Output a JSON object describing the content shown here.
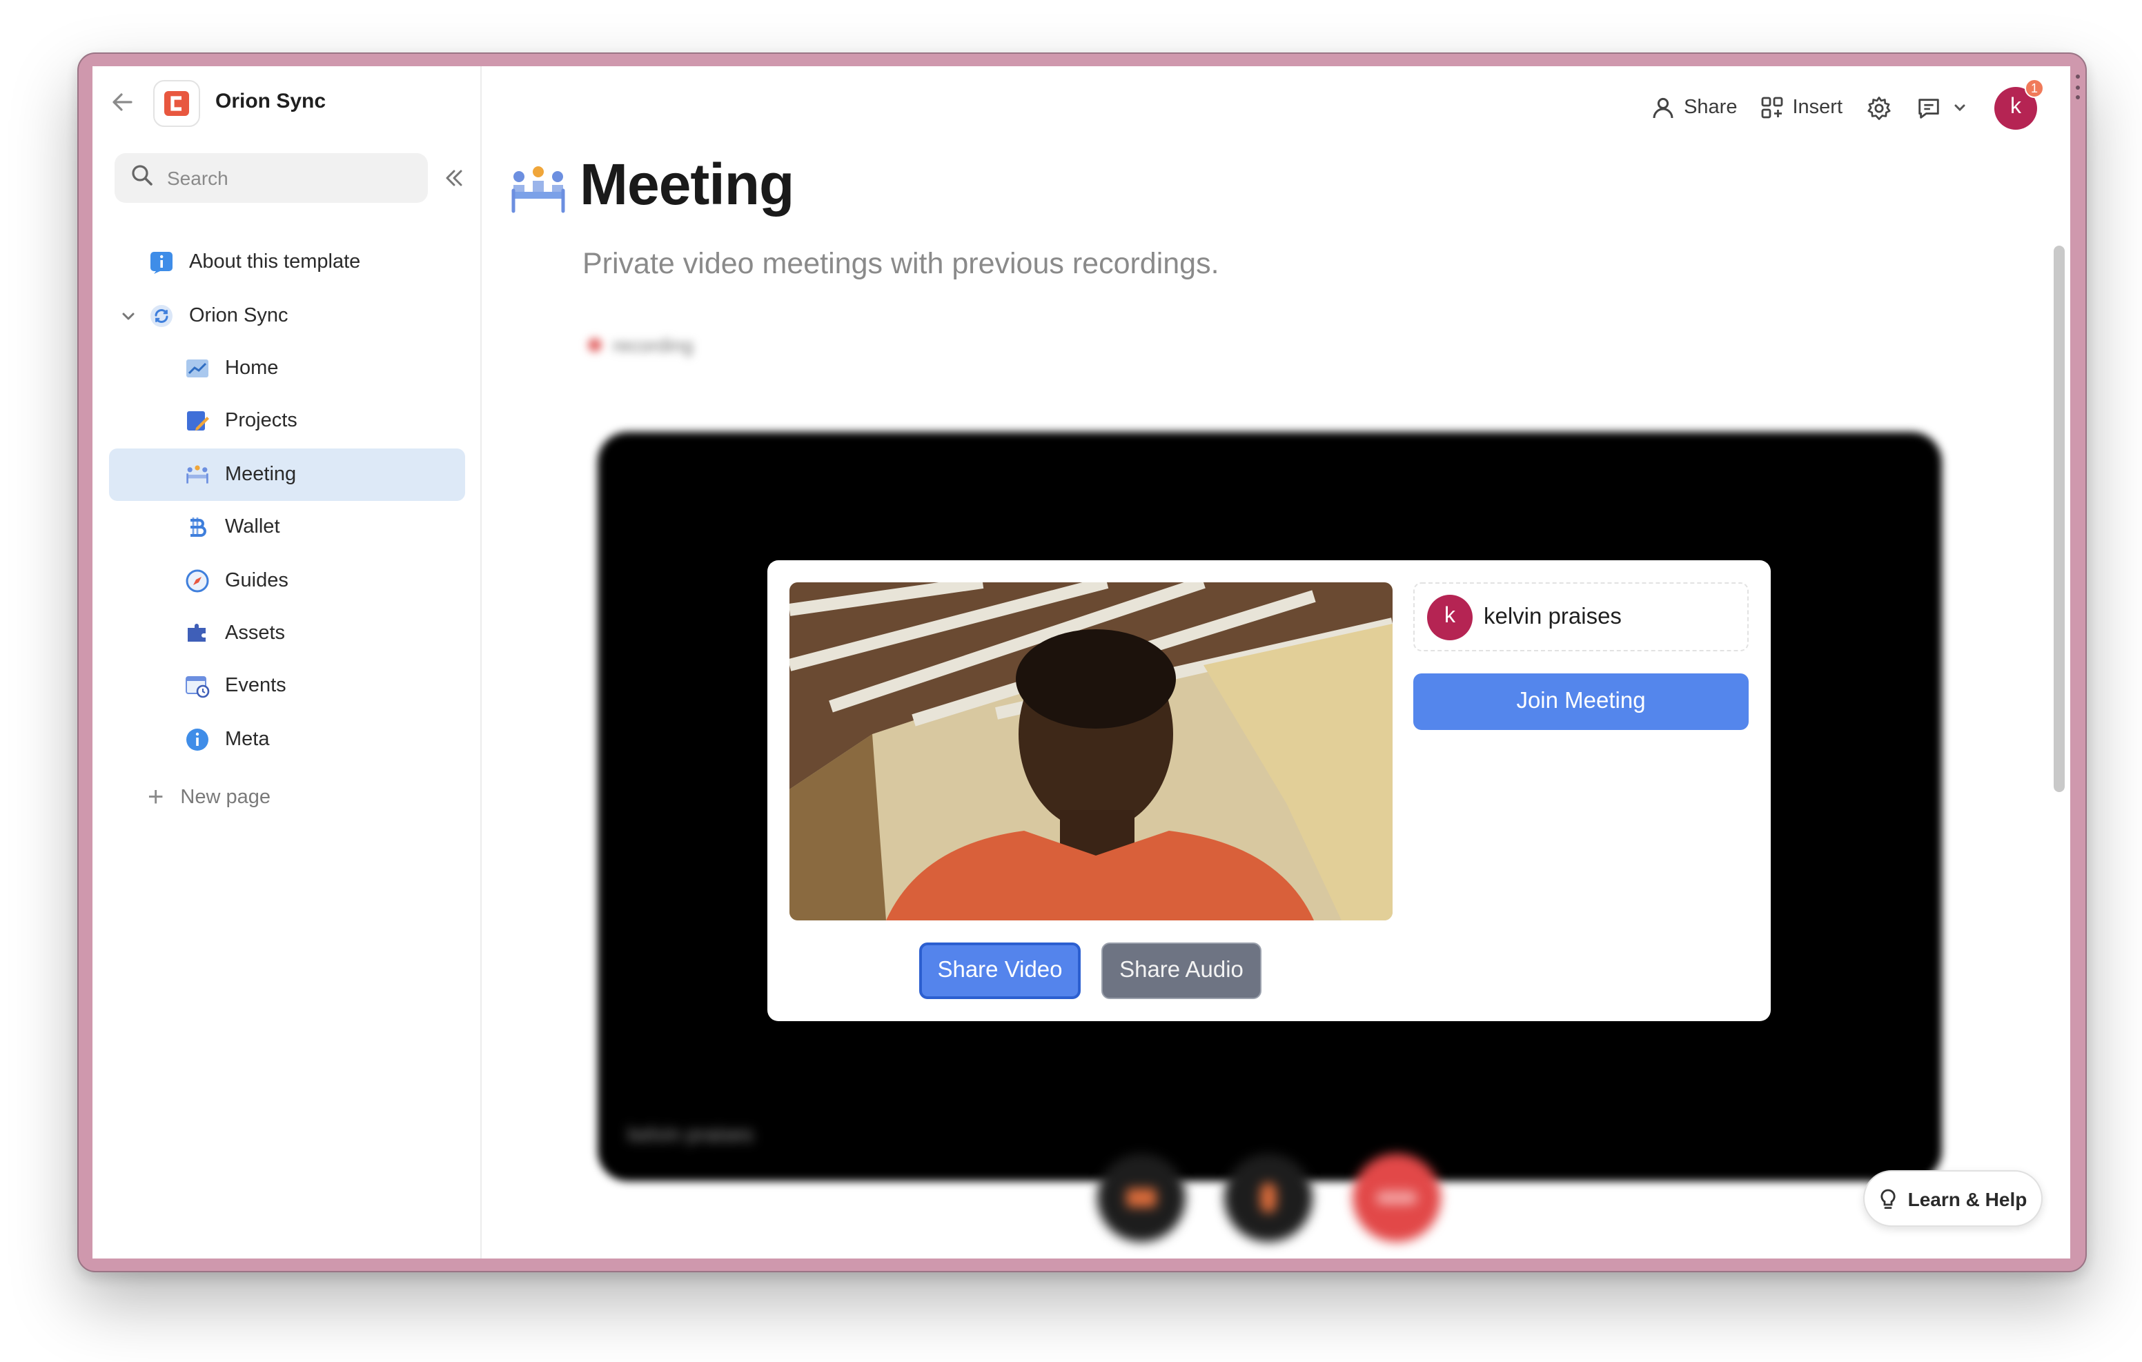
{
  "workspace": {
    "name": "Orion Sync"
  },
  "sidebar": {
    "search_placeholder": "Search",
    "items": [
      {
        "label": "About this template",
        "icon": "info-square-icon",
        "level": 0
      },
      {
        "label": "Orion Sync",
        "icon": "sync-icon",
        "level": 0,
        "expanded": true
      },
      {
        "label": "Home",
        "icon": "chart-icon",
        "level": 1
      },
      {
        "label": "Projects",
        "icon": "pencil-note-icon",
        "level": 1
      },
      {
        "label": "Meeting",
        "icon": "meeting-icon",
        "level": 1,
        "active": true
      },
      {
        "label": "Wallet",
        "icon": "bitcoin-icon",
        "level": 1
      },
      {
        "label": "Guides",
        "icon": "compass-icon",
        "level": 1
      },
      {
        "label": "Assets",
        "icon": "puzzle-icon",
        "level": 1
      },
      {
        "label": "Events",
        "icon": "calendar-clock-icon",
        "level": 1
      },
      {
        "label": "Meta",
        "icon": "info-circle-icon",
        "level": 1
      }
    ],
    "new_page_label": "New page"
  },
  "topbar": {
    "share_label": "Share",
    "insert_label": "Insert",
    "avatar_letter": "k",
    "notification_count": "1"
  },
  "page": {
    "title": "Meeting",
    "subtitle": "Private video meetings with previous recordings.",
    "recording_chip": "recording"
  },
  "meeting": {
    "stage_caption": "kelvin praises",
    "participant": {
      "avatar_letter": "k",
      "name": "kelvin praises"
    },
    "join_label": "Join Meeting",
    "share_video_label": "Share Video",
    "share_audio_label": "Share Audio",
    "end_label": "Leave"
  },
  "help": {
    "label": "Learn & Help"
  },
  "colors": {
    "accent_blue": "#5486ec",
    "avatar": "#b52453",
    "active_nav": "#dde9f7",
    "frame": "#cf98ad"
  }
}
